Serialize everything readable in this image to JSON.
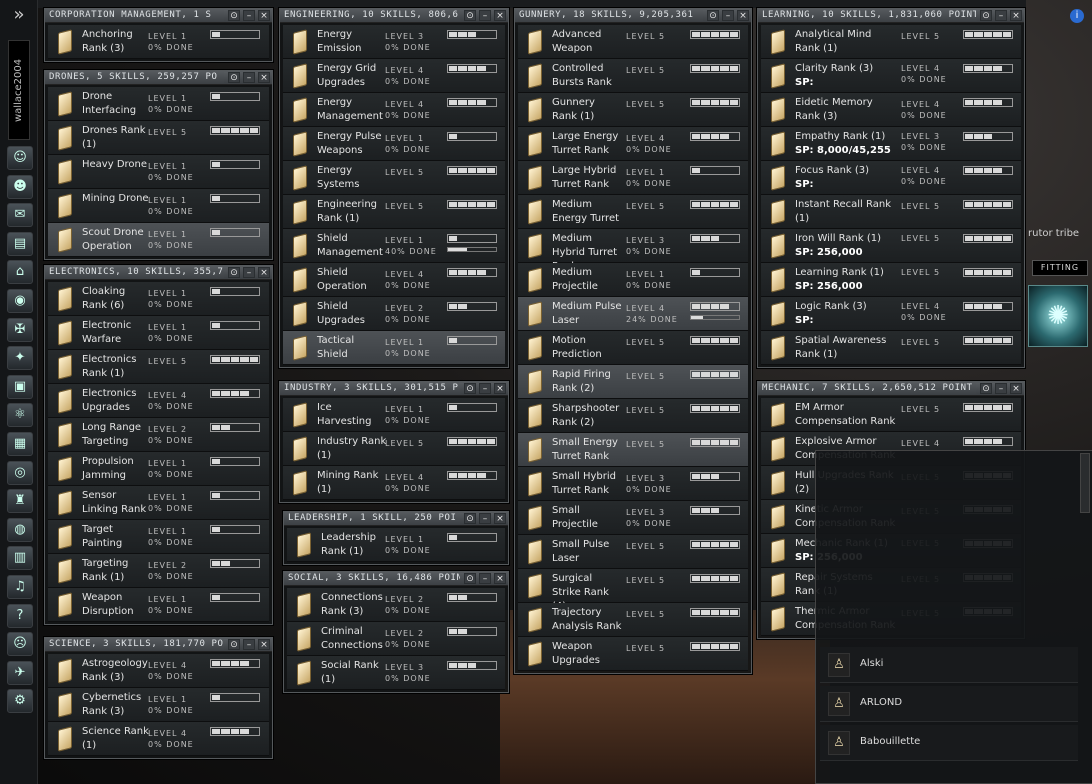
{
  "sidebar": {
    "toggle": "»",
    "pilot_name": "wallace2004",
    "icons": [
      {
        "name": "character-sheet-icon",
        "glyph": "☺"
      },
      {
        "name": "people-places-icon",
        "glyph": "☻"
      },
      {
        "name": "mail-icon",
        "glyph": "✉"
      },
      {
        "name": "notepad-icon",
        "glyph": "▤"
      },
      {
        "name": "cargo-icon",
        "glyph": "⌂"
      },
      {
        "name": "map-icon",
        "glyph": "◉"
      },
      {
        "name": "corporation-icon",
        "glyph": "✠"
      },
      {
        "name": "market-icon",
        "glyph": "✦"
      },
      {
        "name": "assets-icon",
        "glyph": "▣"
      },
      {
        "name": "science-icon",
        "glyph": "⚛"
      },
      {
        "name": "calculator-icon",
        "glyph": "▦"
      },
      {
        "name": "help-icon",
        "glyph": "◎"
      },
      {
        "name": "fleet-icon",
        "glyph": "♜"
      },
      {
        "name": "journal-icon",
        "glyph": "◍"
      },
      {
        "name": "contracts-icon",
        "glyph": "▥"
      },
      {
        "name": "audio-icon",
        "glyph": "♫"
      },
      {
        "name": "question-icon",
        "glyph": "?"
      },
      {
        "name": "mask-icon",
        "glyph": "☹"
      },
      {
        "name": "ship-icon",
        "glyph": "✈"
      },
      {
        "name": "drone-icon",
        "glyph": "⚙"
      }
    ]
  },
  "controls": {
    "lock": "⊙",
    "minimize": "–",
    "close": "×"
  },
  "windows": {
    "corporation": {
      "title": "CORPORATION MANAGEMENT, 1 S",
      "skills": [
        {
          "name": "Anchoring Rank (3)",
          "level": "LEVEL 1",
          "done": "0% DONE",
          "lvl": 1
        }
      ]
    },
    "drones": {
      "title": "DRONES, 5 SKILLS, 259,257 PO",
      "skills": [
        {
          "name": "Drone Interfacing",
          "level": "LEVEL 1",
          "done": "0% DONE",
          "lvl": 1
        },
        {
          "name": "Drones Rank (1)",
          "level": "LEVEL 5",
          "done": "",
          "lvl": 5
        },
        {
          "name": "Heavy Drone",
          "level": "LEVEL 1",
          "done": "0% DONE",
          "lvl": 1
        },
        {
          "name": "Mining Drone",
          "level": "LEVEL 1",
          "done": "0% DONE",
          "lvl": 1
        },
        {
          "name": "Scout Drone Operation",
          "level": "LEVEL 1",
          "done": "0% DONE",
          "lvl": 1,
          "hl": true
        }
      ]
    },
    "electronics": {
      "title": "ELECTRONICS, 10 SKILLS, 355,7",
      "skills": [
        {
          "name": "Cloaking Rank (6)",
          "level": "LEVEL 1",
          "done": "0% DONE",
          "lvl": 1
        },
        {
          "name": "Electronic Warfare",
          "level": "LEVEL 1",
          "done": "0% DONE",
          "lvl": 1
        },
        {
          "name": "Electronics Rank (1)",
          "level": "LEVEL 5",
          "done": "",
          "lvl": 5
        },
        {
          "name": "Electronics Upgrades",
          "level": "LEVEL 4",
          "done": "0% DONE",
          "lvl": 4
        },
        {
          "name": "Long Range Targeting",
          "level": "LEVEL 2",
          "done": "0% DONE",
          "lvl": 2
        },
        {
          "name": "Propulsion Jamming",
          "level": "LEVEL 1",
          "done": "0% DONE",
          "lvl": 1
        },
        {
          "name": "Sensor Linking Rank",
          "level": "LEVEL 1",
          "done": "0% DONE",
          "lvl": 1
        },
        {
          "name": "Target Painting",
          "level": "LEVEL 1",
          "done": "0% DONE",
          "lvl": 1
        },
        {
          "name": "Targeting Rank (1)",
          "level": "LEVEL 2",
          "done": "0% DONE",
          "lvl": 2
        },
        {
          "name": "Weapon Disruption",
          "level": "LEVEL 1",
          "done": "0% DONE",
          "lvl": 1
        }
      ]
    },
    "science": {
      "title": "SCIENCE, 3 SKILLS, 181,770 PO",
      "skills": [
        {
          "name": "Astrogeology Rank (3)",
          "level": "LEVEL 4",
          "done": "0% DONE",
          "lvl": 4
        },
        {
          "name": "Cybernetics Rank (3)",
          "level": "LEVEL 1",
          "done": "0% DONE",
          "lvl": 1
        },
        {
          "name": "Science Rank (1)",
          "level": "LEVEL 4",
          "done": "0% DONE",
          "lvl": 4
        }
      ]
    },
    "engineering": {
      "title": "ENGINEERING, 10 SKILLS, 806,6",
      "skills": [
        {
          "name": "Energy Emission",
          "level": "LEVEL 3",
          "done": "0% DONE",
          "lvl": 3
        },
        {
          "name": "Energy Grid Upgrades",
          "level": "LEVEL 4",
          "done": "0% DONE",
          "lvl": 4
        },
        {
          "name": "Energy Management",
          "level": "LEVEL 4",
          "done": "0% DONE",
          "lvl": 4
        },
        {
          "name": "Energy Pulse Weapons",
          "level": "LEVEL 1",
          "done": "0% DONE",
          "lvl": 1
        },
        {
          "name": "Energy Systems",
          "level": "LEVEL 5",
          "done": "",
          "lvl": 5
        },
        {
          "name": "Engineering Rank (1)",
          "level": "LEVEL 5",
          "done": "",
          "lvl": 5
        },
        {
          "name": "Shield Management",
          "level": "LEVEL 1",
          "done": "40% DONE",
          "lvl": 1,
          "progress": 40
        },
        {
          "name": "Shield Operation",
          "level": "LEVEL 4",
          "done": "0% DONE",
          "lvl": 4
        },
        {
          "name": "Shield Upgrades",
          "level": "LEVEL 2",
          "done": "0% DONE",
          "lvl": 2
        },
        {
          "name": "Tactical Shield",
          "level": "LEVEL 1",
          "done": "0% DONE",
          "lvl": 1,
          "hl": true
        }
      ]
    },
    "industry": {
      "title": "INDUSTRY, 3 SKILLS, 301,515 P",
      "skills": [
        {
          "name": "Ice Harvesting",
          "level": "LEVEL 1",
          "done": "0% DONE",
          "lvl": 1
        },
        {
          "name": "Industry Rank (1)",
          "level": "LEVEL 5",
          "done": "",
          "lvl": 5
        },
        {
          "name": "Mining Rank (1)",
          "level": "LEVEL 4",
          "done": "0% DONE",
          "lvl": 4
        }
      ]
    },
    "leadership": {
      "title": "LEADERSHIP, 1 SKILL, 250 POI",
      "skills": [
        {
          "name": "Leadership Rank (1)",
          "level": "LEVEL 1",
          "done": "0% DONE",
          "lvl": 1
        }
      ]
    },
    "social": {
      "title": "SOCIAL, 3 SKILLS, 16,486 POIN",
      "skills": [
        {
          "name": "Connections Rank (3)",
          "level": "LEVEL 2",
          "done": "0% DONE",
          "lvl": 2
        },
        {
          "name": "Criminal Connections",
          "level": "LEVEL 2",
          "done": "0% DONE",
          "lvl": 2
        },
        {
          "name": "Social Rank (1)",
          "level": "LEVEL 3",
          "done": "0% DONE",
          "lvl": 3
        }
      ]
    },
    "gunnery": {
      "title": "GUNNERY, 18 SKILLS, 9,205,361",
      "skills": [
        {
          "name": "Advanced Weapon",
          "level": "LEVEL 5",
          "done": "",
          "lvl": 5
        },
        {
          "name": "Controlled Bursts Rank",
          "level": "LEVEL 5",
          "done": "",
          "lvl": 5
        },
        {
          "name": "Gunnery Rank (1)",
          "level": "LEVEL 5",
          "done": "",
          "lvl": 5
        },
        {
          "name": "Large Energy Turret Rank",
          "level": "LEVEL 4",
          "done": "0% DONE",
          "lvl": 4
        },
        {
          "name": "Large Hybrid Turret Rank",
          "level": "LEVEL 1",
          "done": "0% DONE",
          "lvl": 1
        },
        {
          "name": "Medium Energy Turret",
          "level": "LEVEL 5",
          "done": "",
          "lvl": 5
        },
        {
          "name": "Medium Hybrid Turret Rank",
          "level": "LEVEL 3",
          "done": "0% DONE",
          "lvl": 3
        },
        {
          "name": "Medium Projectile",
          "level": "LEVEL 1",
          "done": "0% DONE",
          "lvl": 1
        },
        {
          "name": "Medium Pulse Laser",
          "level": "LEVEL 4",
          "done": "24% DONE",
          "lvl": 4,
          "progress": 24,
          "hl": true
        },
        {
          "name": "Motion Prediction",
          "level": "LEVEL 5",
          "done": "",
          "lvl": 5
        },
        {
          "name": "Rapid Firing Rank (2)",
          "level": "LEVEL 5",
          "done": "",
          "lvl": 5,
          "hl": true
        },
        {
          "name": "Sharpshooter Rank (2)",
          "level": "LEVEL 5",
          "done": "",
          "lvl": 5
        },
        {
          "name": "Small Energy Turret Rank",
          "level": "LEVEL 5",
          "done": "",
          "lvl": 5,
          "hl": true
        },
        {
          "name": "Small Hybrid Turret Rank",
          "level": "LEVEL 3",
          "done": "0% DONE",
          "lvl": 3
        },
        {
          "name": "Small Projectile",
          "level": "LEVEL 3",
          "done": "0% DONE",
          "lvl": 3
        },
        {
          "name": "Small Pulse Laser",
          "level": "LEVEL 5",
          "done": "",
          "lvl": 5
        },
        {
          "name": "Surgical Strike Rank (4)",
          "level": "LEVEL 5",
          "done": "",
          "lvl": 5
        },
        {
          "name": "Trajectory Analysis Rank",
          "level": "LEVEL 5",
          "done": "",
          "lvl": 5
        },
        {
          "name": "Weapon Upgrades",
          "level": "LEVEL 5",
          "done": "",
          "lvl": 5
        }
      ]
    },
    "learning": {
      "title": "LEARNING, 10 SKILLS, 1,831,060 POINT",
      "skills": [
        {
          "name": "Analytical Mind Rank (1)",
          "level": "LEVEL 5",
          "done": "",
          "lvl": 5
        },
        {
          "name": "Clarity Rank (3)",
          "level": "LEVEL 4",
          "done": "0% DONE",
          "lvl": 4,
          "sp": "SP:"
        },
        {
          "name": "Eidetic Memory Rank (3)",
          "level": "LEVEL 4",
          "done": "0% DONE",
          "lvl": 4
        },
        {
          "name": "Empathy Rank (1)",
          "level": "LEVEL 3",
          "done": "0% DONE",
          "lvl": 3,
          "sp": "SP: 8,000/45,255"
        },
        {
          "name": "Focus Rank (3)",
          "level": "LEVEL 4",
          "done": "0% DONE",
          "lvl": 4,
          "sp": "SP:"
        },
        {
          "name": "Instant Recall Rank (1)",
          "level": "LEVEL 5",
          "done": "",
          "lvl": 5
        },
        {
          "name": "Iron Will Rank (1)",
          "level": "LEVEL 5",
          "done": "",
          "lvl": 5,
          "sp": "SP: 256,000"
        },
        {
          "name": "Learning Rank (1)",
          "level": "LEVEL 5",
          "done": "",
          "lvl": 5,
          "sp": "SP: 256,000"
        },
        {
          "name": "Logic Rank (3)",
          "level": "LEVEL 4",
          "done": "0% DONE",
          "lvl": 4,
          "sp": "SP:"
        },
        {
          "name": "Spatial Awareness Rank (1)",
          "level": "LEVEL 5",
          "done": "",
          "lvl": 5
        }
      ]
    },
    "mechanic": {
      "title": "MECHANIC, 7 SKILLS, 2,650,512 POINT",
      "skills": [
        {
          "name": "EM Armor Compensation Rank",
          "level": "LEVEL 5",
          "done": "",
          "lvl": 5
        },
        {
          "name": "Explosive Armor Compensation Rank",
          "level": "LEVEL 4",
          "done": "",
          "lvl": 4
        },
        {
          "name": "Hull Upgrades Rank (2)",
          "level": "LEVEL 5",
          "done": "",
          "lvl": 5
        },
        {
          "name": "Kinetic Armor Compensation Rank",
          "level": "LEVEL 5",
          "done": "",
          "lvl": 5
        },
        {
          "name": "Mechanic Rank (1)",
          "level": "LEVEL 5",
          "done": "",
          "lvl": 5,
          "sp": "SP: 256,000"
        },
        {
          "name": "Repair Systems Rank (1)",
          "level": "LEVEL 5",
          "done": "",
          "lvl": 5
        },
        {
          "name": "Thermic Armor Compensation Rank",
          "level": "LEVEL 5",
          "done": "",
          "lvl": 5
        }
      ]
    }
  },
  "right": {
    "info": "i",
    "corp_text": "rutor tribe",
    "fitting": "FITTING",
    "ship_glyph": "✺"
  },
  "people": [
    {
      "name": "Alski"
    },
    {
      "name": "ARLOND"
    },
    {
      "name": "Babouillette"
    }
  ]
}
